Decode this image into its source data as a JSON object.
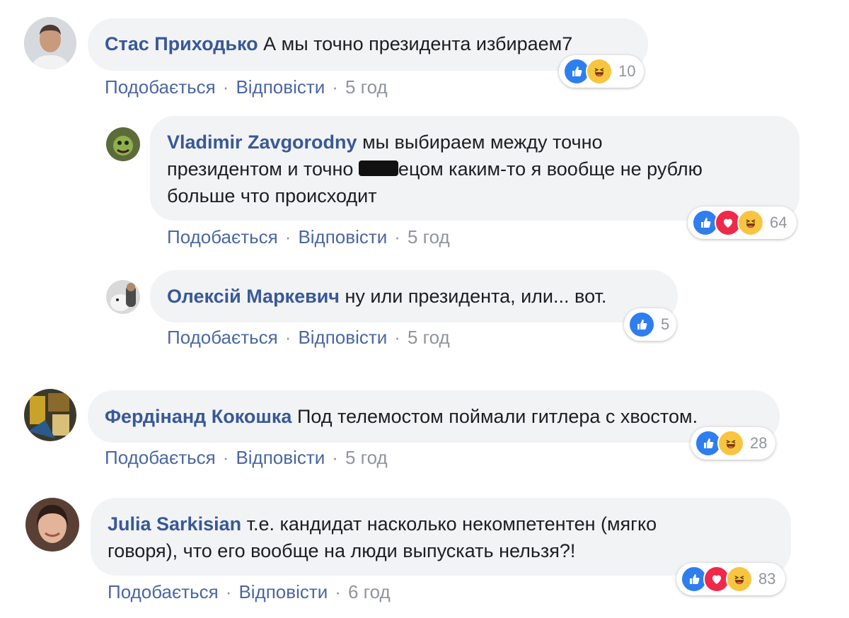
{
  "comments": [
    {
      "author": "Стас Приходько",
      "text": "А мы точно президента избираем7",
      "like": "Подобається",
      "reply": "Відповісти",
      "time": "5 год",
      "reaction_count": "10",
      "reactions": [
        "like",
        "haha"
      ]
    },
    {
      "author": "Vladimir Zavgorodny",
      "text_line1": "мы выбираем между точно",
      "text_line2_a": "президентом и точно ",
      "text_line2_b": "ецом каким-то я вообще не рублю",
      "text_line3": "больше что происходит",
      "like": "Подобається",
      "reply": "Відповісти",
      "time": "5 год",
      "reaction_count": "64",
      "reactions": [
        "like",
        "love",
        "haha"
      ]
    },
    {
      "author": "Олексій Маркевич",
      "text": "ну или президента, или... вот.",
      "like": "Подобається",
      "reply": "Відповісти",
      "time": "5 год",
      "reaction_count": "5",
      "reactions": [
        "like"
      ]
    },
    {
      "author": "Фердінанд Кокошка",
      "text": "Под телемостом поймали гитлера с хвостом.",
      "like": "Подобається",
      "reply": "Відповісти",
      "time": "5 год",
      "reaction_count": "28",
      "reactions": [
        "like",
        "haha"
      ]
    },
    {
      "author": "Julia Sarkisian",
      "text_line1": "т.е. кандидат насколько некомпетентен (мягко",
      "text_line2": "говоря), что его вообще на люди выпускать нельзя?!",
      "like": "Подобається",
      "reply": "Відповісти",
      "time": "6 год",
      "reaction_count": "83",
      "reactions": [
        "like",
        "love",
        "haha"
      ]
    }
  ],
  "separator": "·",
  "colors": {
    "name": "#385898",
    "bubble": "#f2f3f5",
    "like": "#2e7ef0",
    "love": "#f0284a",
    "haha": "#f7c540"
  }
}
